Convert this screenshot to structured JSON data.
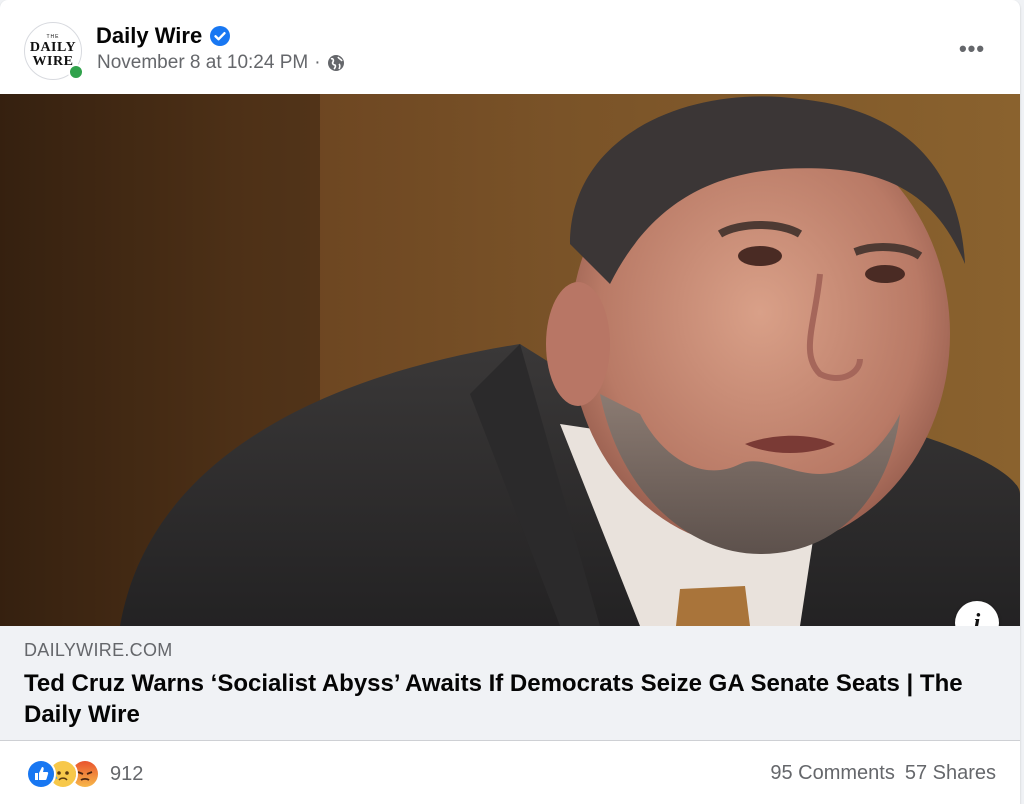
{
  "post": {
    "page_name": "Daily Wire",
    "verified_icon": "verified-badge-icon",
    "timestamp": "November 8 at 10:24 PM",
    "separator": "·",
    "privacy_icon": "globe-icon",
    "more_icon": "more-options-icon",
    "more_label": "•••",
    "avatar": {
      "small_text": "THE",
      "line1": "DAILY",
      "line2": "WIRE"
    }
  },
  "photo": {
    "info_label": "i"
  },
  "link": {
    "domain": "DAILYWIRE.COM",
    "title": "Ted Cruz Warns ‘Socialist Abyss’ Awaits If Democrats Seize GA Senate Seats | The Daily Wire"
  },
  "engagement": {
    "reaction_icons": [
      "like-icon",
      "sad-icon",
      "angry-icon"
    ],
    "reaction_count": "912",
    "comments": "95 Comments",
    "shares": "57 Shares"
  },
  "colors": {
    "accent": "#1877f2",
    "meta_text": "#65676b",
    "online": "#31a24c"
  }
}
